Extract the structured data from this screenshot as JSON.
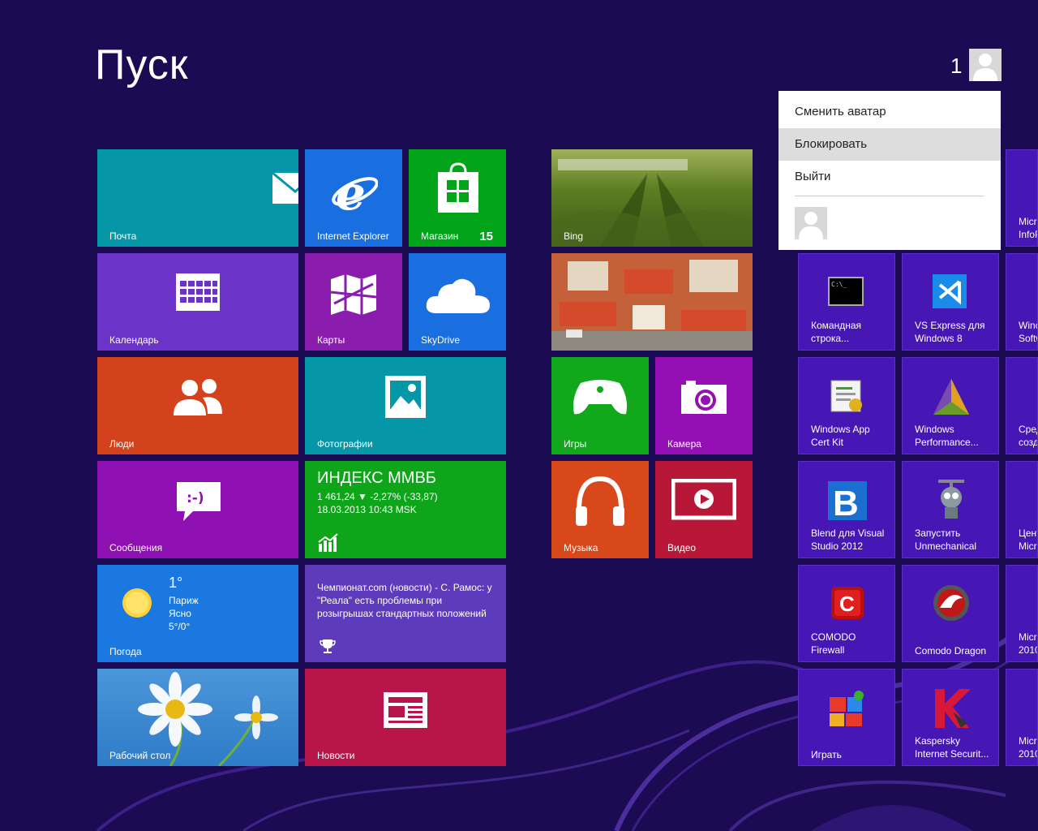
{
  "start": {
    "title": "Пуск",
    "user_count": "1"
  },
  "user_menu": {
    "items": [
      "Сменить аватар",
      "Блокировать",
      "Выйти"
    ],
    "highlighted": "Блокировать"
  },
  "tiles": {
    "mail": "Почта",
    "ie": "Internet Explorer",
    "store": "Магазин",
    "store_badge": "15",
    "bing": "Bing",
    "calendar": "Календарь",
    "maps": "Карты",
    "skydrive": "SkyDrive",
    "people": "Люди",
    "photos": "Фотографии",
    "games": "Игры",
    "camera": "Камера",
    "messages": "Сообщения",
    "music": "Музыка",
    "video": "Видео",
    "weather": "Погода",
    "desktop": "Рабочий стол",
    "news": "Новости"
  },
  "finance": {
    "title": "ИНДЕКС ММВБ",
    "line1": "1 461,24  ▼ -2,27% (-33,87)",
    "line2": "18.03.2013 10:43 MSK"
  },
  "weather": {
    "temp": "1°",
    "city": "Париж",
    "condition": "Ясно",
    "range": "5°/0°"
  },
  "sports": {
    "headline": "Чемпионат.com  (новости) - С. Рамос: у \"Реала\" есть проблемы при розыгрышах стандартных положений"
  },
  "apps": [
    {
      "l1": "Командная",
      "l2": "строка..."
    },
    {
      "l1": "VS Express для",
      "l2": "Windows 8"
    },
    {
      "l1": "Windows App",
      "l2": "Cert Kit"
    },
    {
      "l1": "Windows",
      "l2": "Performance..."
    },
    {
      "l1": "Blend для Visual",
      "l2": "Studio 2012"
    },
    {
      "l1": "Запустить",
      "l2": "Unmechanical"
    },
    {
      "l1": "COMODO",
      "l2": "Firewall"
    },
    {
      "l1": "Comodo Dragon",
      "l2": ""
    },
    {
      "l1": "Играть",
      "l2": ""
    },
    {
      "l1": "Kaspersky",
      "l2": "Internet Securit..."
    }
  ],
  "partial_apps": [
    {
      "l1": "Micr",
      "l2": "InfoP"
    },
    {
      "l1": "Winc",
      "l2": "Softw"
    },
    {
      "l1": "Сред",
      "l2": "созд"
    },
    {
      "l1": "Цент",
      "l2": "Micro"
    },
    {
      "l1": "Micr",
      "l2": "2010"
    },
    {
      "l1": "Micr",
      "l2": "2010"
    }
  ],
  "colors": {
    "background": "#1b0b52",
    "mail": "#0597a7",
    "ie": "#1a6fe0",
    "store": "#02a51a",
    "calendar": "#6b33c7",
    "maps": "#8a1cae",
    "skydrive": "#1a6fe0",
    "people": "#d4421d",
    "photos": "#0597a7",
    "games": "#11a81c",
    "camera": "#9410b4",
    "messages": "#8f10b2",
    "finance": "#0ea51a",
    "music": "#d9481a",
    "video": "#b81738",
    "weather": "#1a78e0",
    "sports": "#5e3bbb",
    "desktop": "#3b86d1",
    "news": "#b8154a",
    "app": "#4617b4"
  }
}
